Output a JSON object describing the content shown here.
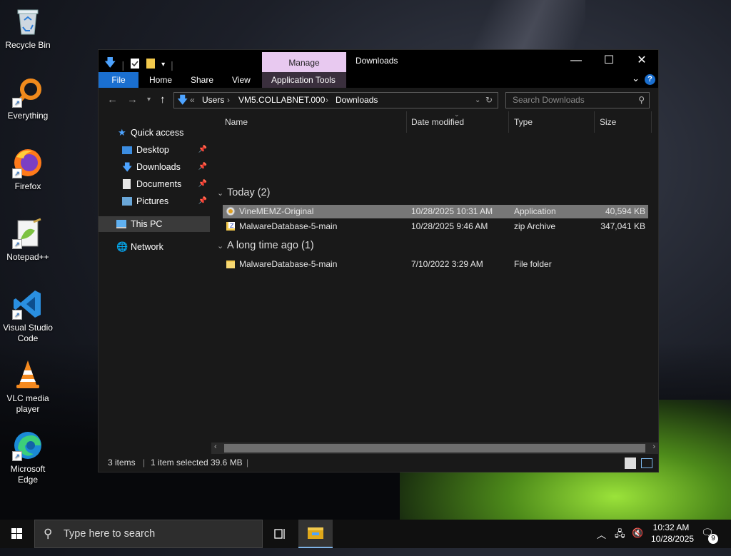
{
  "desktop": {
    "icons": [
      {
        "label": "Recycle Bin"
      },
      {
        "label": "Everything"
      },
      {
        "label": "Firefox"
      },
      {
        "label": "Notepad++"
      },
      {
        "label": "Visual Studio Code"
      },
      {
        "label": "VLC media player"
      },
      {
        "label": "Microsoft Edge"
      }
    ]
  },
  "window": {
    "title": "Downloads",
    "manage_tab": "Manage",
    "ribbon_tabs": [
      "File",
      "Home",
      "Share",
      "View",
      "Application Tools"
    ],
    "help": "?",
    "address": {
      "overflow": "«",
      "crumbs": [
        "Users",
        "VM5.COLLABNET.000",
        "Downloads"
      ]
    },
    "search_placeholder": "Search Downloads",
    "sidebar": [
      {
        "label": "Quick access"
      },
      {
        "label": "Desktop",
        "pinned": true
      },
      {
        "label": "Downloads",
        "pinned": true
      },
      {
        "label": "Documents",
        "pinned": true
      },
      {
        "label": "Pictures",
        "pinned": true
      },
      {
        "label": "This PC"
      },
      {
        "label": "Network"
      }
    ],
    "columns": [
      "Name",
      "Date modified",
      "Type",
      "Size"
    ],
    "groups": [
      {
        "title": "Today (2)",
        "rows": [
          {
            "name": "VineMEMZ-Original",
            "date": "10/28/2025 10:31 AM",
            "type": "Application",
            "size": "40,594 KB",
            "selected": true
          },
          {
            "name": "MalwareDatabase-5-main",
            "date": "10/28/2025 9:46 AM",
            "type": "zip Archive",
            "size": "347,041 KB"
          }
        ]
      },
      {
        "title": "A long time ago (1)",
        "rows": [
          {
            "name": "MalwareDatabase-5-main",
            "date": "7/10/2022 3:29 AM",
            "type": "File folder",
            "size": ""
          }
        ]
      }
    ],
    "status": {
      "items": "3 items",
      "selected": "1 item selected",
      "size": "39.6 MB"
    }
  },
  "taskbar": {
    "search_placeholder": "Type here to search",
    "time": "10:32 AM",
    "date": "10/28/2025",
    "notification_count": "9"
  },
  "colors": {
    "ribbon_file": "#1a6fd0",
    "manage_tab": "#e8c9f0",
    "selection": "#777777",
    "folder": "#f2c94c"
  }
}
